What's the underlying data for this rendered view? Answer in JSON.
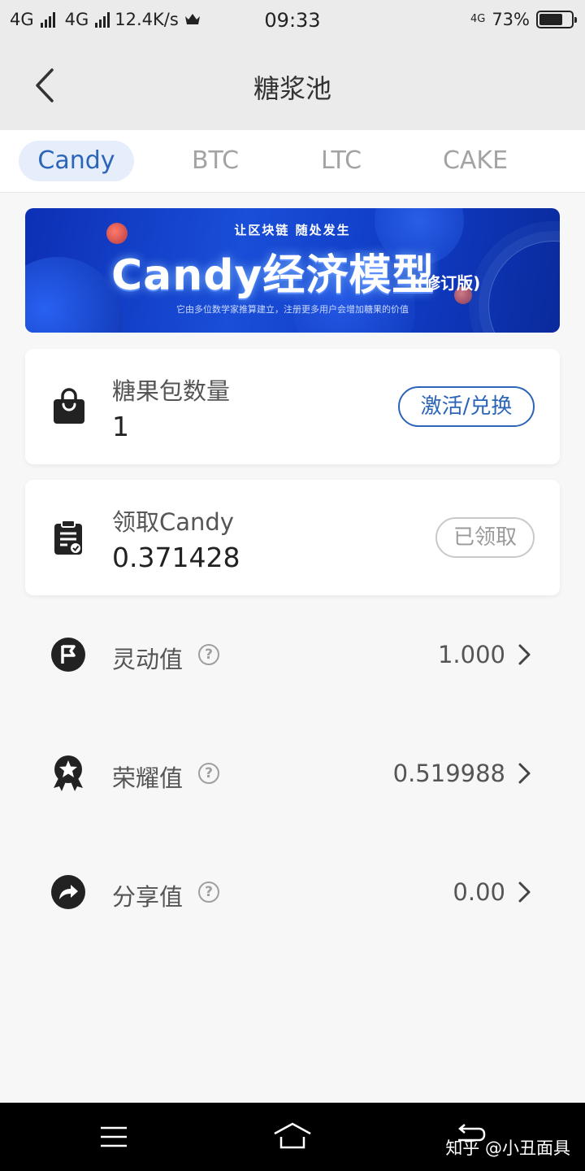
{
  "status_bar": {
    "network1": "4G",
    "network2": "4G",
    "speed": "12.4K/s",
    "time": "09:33",
    "network_badge": "4G",
    "battery": "73%",
    "battery_level": 0.73
  },
  "header": {
    "title": "糖浆池",
    "back_icon": "chevron-left-icon"
  },
  "tabs": [
    {
      "label": "Candy",
      "active": true
    },
    {
      "label": "BTC",
      "active": false
    },
    {
      "label": "LTC",
      "active": false
    },
    {
      "label": "CAKE",
      "active": false
    }
  ],
  "banner": {
    "top_text": "让区块链 随处发生",
    "main_text": "Candy经济模型",
    "tag_text": "(修订版)",
    "sub_text": "它由多位数学家推算建立，注册更多用户会增加糖果的价值",
    "colors": {
      "bg": "#1a4ed8",
      "glow": "#5b8cff"
    }
  },
  "cards": [
    {
      "label": "糖果包数量",
      "value": "1",
      "button": "激活/兑换",
      "icon": "shopping-bag-icon"
    },
    {
      "label": "领取Candy",
      "value": "0.371428",
      "button": "已领取",
      "icon": "clipboard-icon"
    }
  ],
  "stats": [
    {
      "label": "灵动值",
      "value": "1.000",
      "icon": "flag-icon"
    },
    {
      "label": "荣耀值",
      "value": "0.519988",
      "icon": "medal-icon"
    },
    {
      "label": "分享值",
      "value": "0.00",
      "icon": "share-icon"
    }
  ],
  "navbar": {
    "watermark": "知乎 @小丑面具"
  },
  "colors": {
    "accent": "#2c65b8",
    "tab_active_bg": "#e6eefb",
    "page_bg": "#f7f7f7",
    "header_bg": "#ebebeb"
  }
}
